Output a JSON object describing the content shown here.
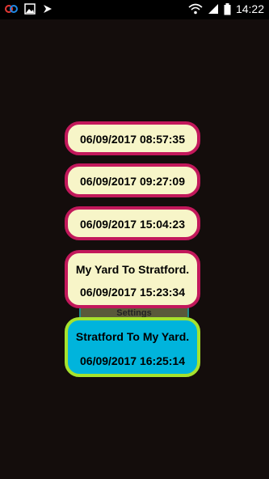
{
  "status_bar": {
    "time": "14:22",
    "icons": [
      "app-notification-icon",
      "image-icon",
      "app-icon",
      "wifi-icon",
      "signal-icon",
      "battery-icon"
    ]
  },
  "entries": [
    {
      "title": "",
      "datetime": "06/09/2017 08:57:35"
    },
    {
      "title": "",
      "datetime": "06/09/2017 09:27:09"
    },
    {
      "title": "",
      "datetime": "06/09/2017 15:04:23"
    },
    {
      "title": "My Yard To Stratford.",
      "datetime": "06/09/2017 15:23:34"
    },
    {
      "title": "Stratford To My Yard.",
      "datetime": "06/09/2017 16:25:14"
    }
  ],
  "settings_label": "Settings",
  "colors": {
    "background": "#140d0c",
    "card_fill": "#f7f5c8",
    "card_border": "#c2185b",
    "active_fill": "#00b4dc",
    "active_border": "#a6e22e"
  }
}
